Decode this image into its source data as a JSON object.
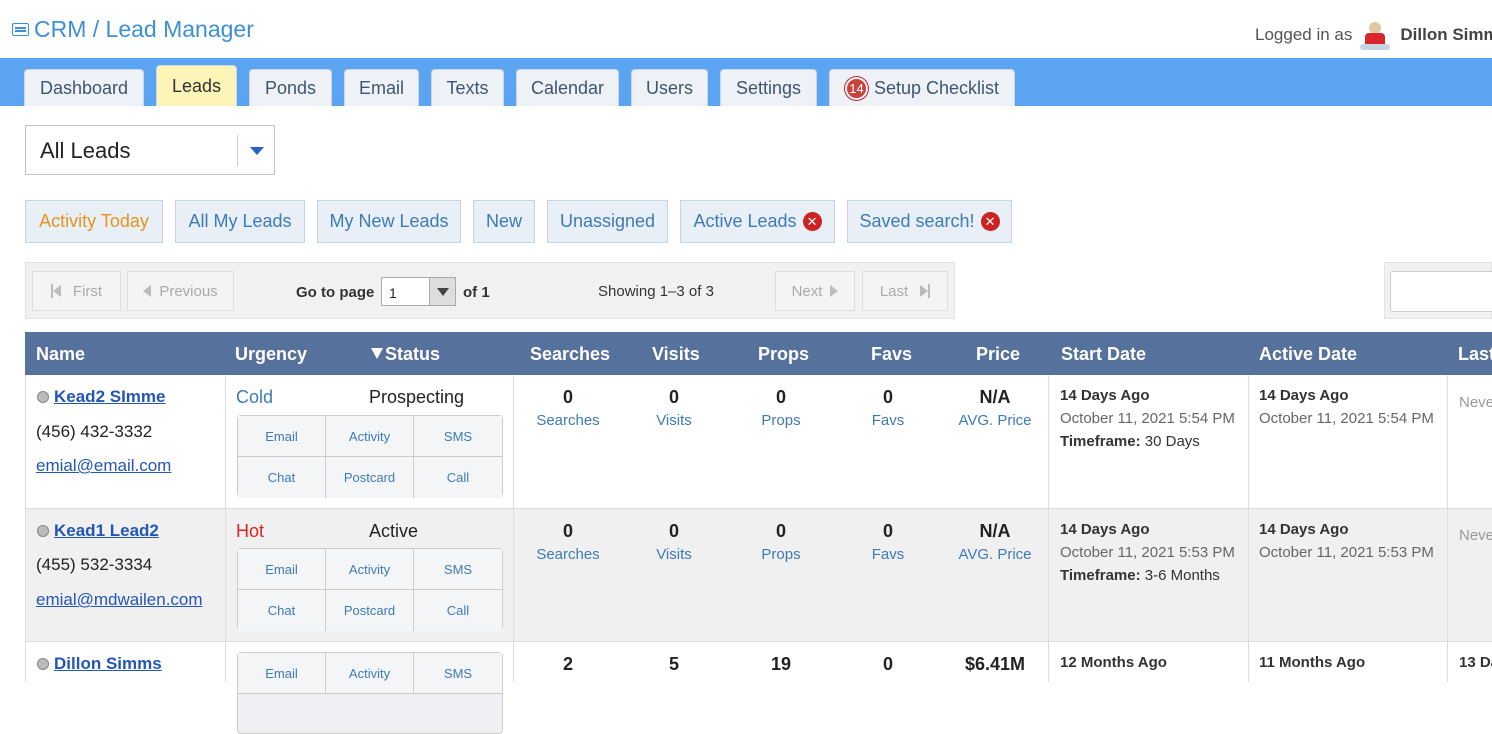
{
  "header": {
    "app_title": "CRM / Lead Manager",
    "logged_in_label": "Logged in as",
    "user_name": "Dillon Simms"
  },
  "tabs": [
    {
      "label": "Dashboard"
    },
    {
      "label": "Leads",
      "active": true
    },
    {
      "label": "Ponds"
    },
    {
      "label": "Email"
    },
    {
      "label": "Texts"
    },
    {
      "label": "Calendar"
    },
    {
      "label": "Users"
    },
    {
      "label": "Settings"
    },
    {
      "label": "Setup Checklist",
      "badge": "14"
    }
  ],
  "view_select": {
    "value": "All Leads"
  },
  "filters": {
    "activity_today": "Activity Today",
    "all_my_leads": "All My Leads",
    "my_new_leads": "My New Leads",
    "new": "New",
    "unassigned": "Unassigned",
    "active_leads": "Active Leads",
    "saved_search": "Saved search!",
    "remove_glyph": "✕"
  },
  "pager": {
    "first": "First",
    "previous": "Previous",
    "go_to_page": "Go to page",
    "page": "1",
    "of": "of 1",
    "showing": "Showing 1–3 of 3",
    "next": "Next",
    "last": "Last"
  },
  "columns": {
    "name": "Name",
    "urgency": "Urgency",
    "status": "Status",
    "searches": "Searches",
    "visits": "Visits",
    "props": "Props",
    "favs": "Favs",
    "price": "Price",
    "start_date": "Start Date",
    "active_date": "Active Date",
    "last": "Last"
  },
  "action_labels": {
    "email": "Email",
    "activity": "Activity",
    "sms": "SMS",
    "chat": "Chat",
    "postcard": "Postcard",
    "call": "Call"
  },
  "stat_labels": {
    "searches": "Searches",
    "visits": "Visits",
    "props": "Props",
    "favs": "Favs",
    "price": "AVG. Price",
    "timeframe": "Timeframe:"
  },
  "rows": [
    {
      "name": "Kead2 SImme",
      "phone": "(456) 432-3332",
      "email": "emial@email.com",
      "urgency": "Cold",
      "status": "Prospecting",
      "searches": "0",
      "visits": "0",
      "props": "0",
      "favs": "0",
      "price": "N/A",
      "start_rel": "14 Days Ago",
      "start_abs": "October 11, 2021 5:54 PM",
      "timeframe": "30 Days",
      "active_rel": "14 Days Ago",
      "active_abs": "October 11, 2021 5:54 PM",
      "last": "Neve"
    },
    {
      "name": "Kead1 Lead2",
      "phone": "(455) 532-3334",
      "email": "emial@mdwailen.com",
      "urgency": "Hot",
      "status": "Active",
      "searches": "0",
      "visits": "0",
      "props": "0",
      "favs": "0",
      "price": "N/A",
      "start_rel": "14 Days Ago",
      "start_abs": "October 11, 2021 5:53 PM",
      "timeframe": "3-6 Months",
      "active_rel": "14 Days Ago",
      "active_abs": "October 11, 2021 5:53 PM",
      "last": "Neve"
    },
    {
      "name": "Dillon Simms",
      "searches": "2",
      "visits": "5",
      "props": "19",
      "favs": "0",
      "price": "$6.41M",
      "start_rel": "12 Months Ago",
      "active_rel": "11 Months Ago",
      "last": "13 Da"
    }
  ]
}
